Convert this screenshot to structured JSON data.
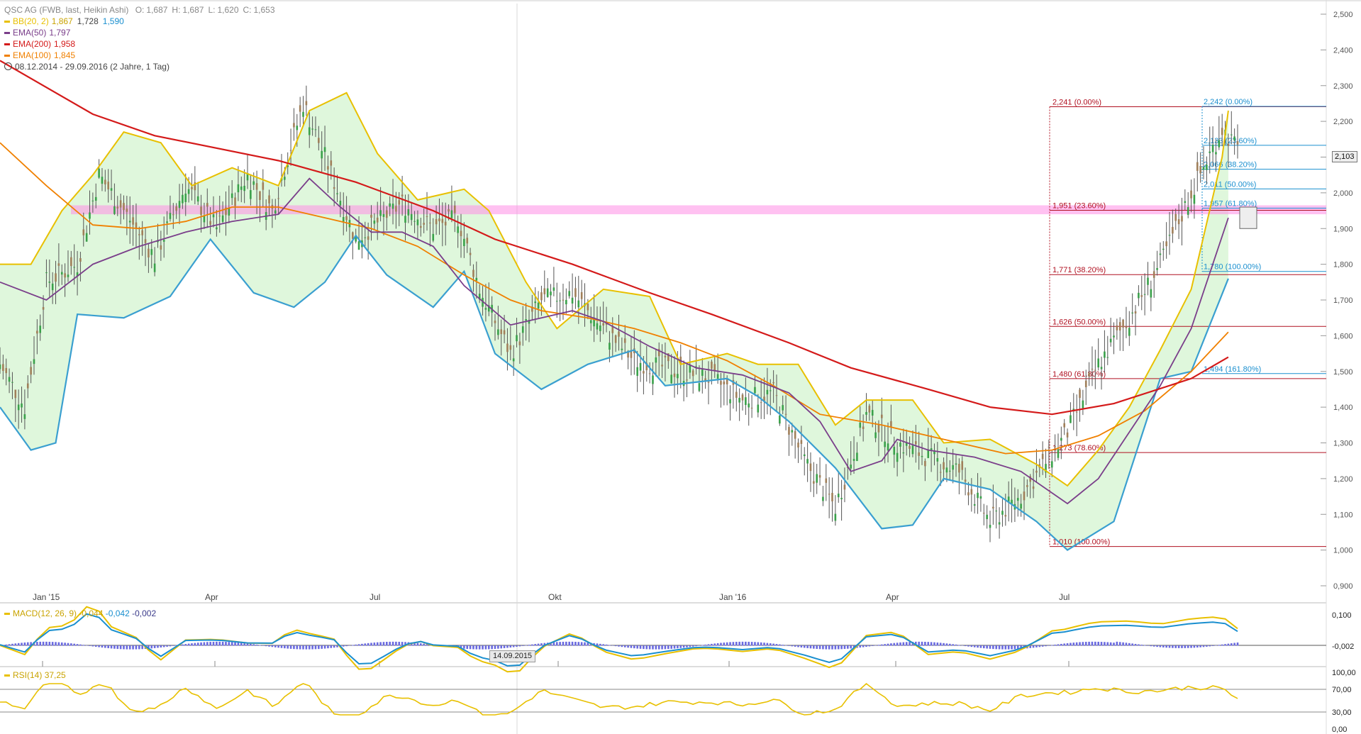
{
  "header": {
    "title": "QSC AG (FWB, last, Heikin Ashi)",
    "ohlc": [
      {
        "k": "O:",
        "v": "1,687"
      },
      {
        "k": "H:",
        "v": "1,687"
      },
      {
        "k": "L:",
        "v": "1,620"
      },
      {
        "k": "C:",
        "v": "1,653"
      }
    ],
    "indicators": [
      {
        "name": "BB(20, 2)",
        "values": [
          "1,867",
          "1,728",
          "1,590"
        ],
        "color": "#e8c000",
        "value_colors": [
          "#c9a300",
          "#444444",
          "#1a8fcf"
        ]
      },
      {
        "name": "EMA(50)",
        "values": [
          "1,797"
        ],
        "color": "#7a3e8a",
        "value_colors": [
          "#7a3e8a"
        ]
      },
      {
        "name": "EMA(200)",
        "values": [
          "1,958"
        ],
        "color": "#d41a1a",
        "value_colors": [
          "#d41a1a"
        ]
      },
      {
        "name": "EMA(100)",
        "values": [
          "1,845"
        ],
        "color": "#f08000",
        "value_colors": [
          "#f08000"
        ]
      }
    ],
    "range": "08.12.2014 - 29.09.2016 (2 Jahre, 1 Tag)"
  },
  "macd_label": {
    "name": "MACD(12, 26, 9)",
    "values": [
      "-0,044",
      "-0,042",
      "-0,002"
    ]
  },
  "rsi_label": {
    "name": "RSI(14)",
    "values": [
      "37,25"
    ]
  },
  "cursor_date": "14.09.2015",
  "last_price": "2,103",
  "chart_data": {
    "type": "line",
    "price_axis": {
      "ticks": [
        "2,500",
        "2,400",
        "2,300",
        "2,200",
        "2,100",
        "2,000",
        "1,900",
        "1,800",
        "1,700",
        "1,600",
        "1,500",
        "1,400",
        "1,300",
        "1,200",
        "1,100",
        "1,000",
        "0,900"
      ],
      "ylim": [
        0.9,
        2.5
      ]
    },
    "time_axis": {
      "labels": [
        "Jan '15",
        "Apr",
        "Jul",
        "Okt",
        "Jan '16",
        "Apr",
        "Jul"
      ]
    },
    "series": [
      {
        "name": "EMA(200)",
        "color": "#d41a1a",
        "points": [
          [
            0,
            2.37
          ],
          [
            30,
            2.22
          ],
          [
            50,
            2.16
          ],
          [
            90,
            2.09
          ],
          [
            115,
            2.03
          ],
          [
            140,
            1.95
          ],
          [
            160,
            1.87
          ],
          [
            185,
            1.8
          ],
          [
            210,
            1.72
          ],
          [
            230,
            1.66
          ],
          [
            255,
            1.58
          ],
          [
            275,
            1.51
          ],
          [
            300,
            1.45
          ],
          [
            320,
            1.4
          ],
          [
            340,
            1.38
          ],
          [
            360,
            1.41
          ],
          [
            385,
            1.48
          ],
          [
            397,
            1.54
          ]
        ]
      },
      {
        "name": "EMA(100)",
        "color": "#f08000",
        "points": [
          [
            0,
            2.14
          ],
          [
            15,
            2.02
          ],
          [
            30,
            1.91
          ],
          [
            45,
            1.9
          ],
          [
            60,
            1.92
          ],
          [
            75,
            1.96
          ],
          [
            90,
            1.96
          ],
          [
            105,
            1.93
          ],
          [
            120,
            1.9
          ],
          [
            135,
            1.85
          ],
          [
            150,
            1.77
          ],
          [
            165,
            1.7
          ],
          [
            175,
            1.67
          ],
          [
            190,
            1.65
          ],
          [
            205,
            1.62
          ],
          [
            220,
            1.58
          ],
          [
            235,
            1.53
          ],
          [
            250,
            1.46
          ],
          [
            265,
            1.38
          ],
          [
            285,
            1.35
          ],
          [
            305,
            1.31
          ],
          [
            325,
            1.27
          ],
          [
            340,
            1.28
          ],
          [
            355,
            1.32
          ],
          [
            370,
            1.39
          ],
          [
            385,
            1.5
          ],
          [
            397,
            1.61
          ]
        ]
      },
      {
        "name": "EMA(50)",
        "color": "#7a3e8a",
        "points": [
          [
            0,
            1.75
          ],
          [
            15,
            1.7
          ],
          [
            30,
            1.8
          ],
          [
            45,
            1.85
          ],
          [
            60,
            1.89
          ],
          [
            75,
            1.92
          ],
          [
            90,
            1.94
          ],
          [
            100,
            2.04
          ],
          [
            110,
            1.96
          ],
          [
            120,
            1.89
          ],
          [
            130,
            1.89
          ],
          [
            140,
            1.85
          ],
          [
            150,
            1.74
          ],
          [
            165,
            1.63
          ],
          [
            175,
            1.65
          ],
          [
            185,
            1.67
          ],
          [
            195,
            1.64
          ],
          [
            210,
            1.57
          ],
          [
            225,
            1.51
          ],
          [
            240,
            1.49
          ],
          [
            255,
            1.44
          ],
          [
            265,
            1.36
          ],
          [
            275,
            1.22
          ],
          [
            285,
            1.25
          ],
          [
            290,
            1.31
          ],
          [
            300,
            1.28
          ],
          [
            315,
            1.26
          ],
          [
            330,
            1.22
          ],
          [
            345,
            1.13
          ],
          [
            355,
            1.2
          ],
          [
            365,
            1.33
          ],
          [
            375,
            1.46
          ],
          [
            385,
            1.62
          ],
          [
            397,
            1.93
          ]
        ]
      },
      {
        "name": "BB upper",
        "color": "#e8c000",
        "points": [
          [
            0,
            1.8
          ],
          [
            10,
            1.8
          ],
          [
            20,
            1.95
          ],
          [
            30,
            2.05
          ],
          [
            40,
            2.17
          ],
          [
            52,
            2.14
          ],
          [
            62,
            2.02
          ],
          [
            75,
            2.07
          ],
          [
            90,
            2.02
          ],
          [
            100,
            2.23
          ],
          [
            112,
            2.28
          ],
          [
            122,
            2.11
          ],
          [
            135,
            1.98
          ],
          [
            150,
            2.01
          ],
          [
            158,
            1.95
          ],
          [
            170,
            1.75
          ],
          [
            180,
            1.62
          ],
          [
            195,
            1.73
          ],
          [
            210,
            1.71
          ],
          [
            220,
            1.52
          ],
          [
            235,
            1.55
          ],
          [
            245,
            1.52
          ],
          [
            258,
            1.52
          ],
          [
            270,
            1.35
          ],
          [
            280,
            1.42
          ],
          [
            295,
            1.42
          ],
          [
            305,
            1.3
          ],
          [
            320,
            1.31
          ],
          [
            335,
            1.24
          ],
          [
            345,
            1.18
          ],
          [
            355,
            1.28
          ],
          [
            365,
            1.4
          ],
          [
            375,
            1.56
          ],
          [
            385,
            1.73
          ],
          [
            395,
            2.1
          ],
          [
            397,
            2.23
          ]
        ]
      },
      {
        "name": "BB lower",
        "color": "#3a9fd0",
        "points": [
          [
            0,
            1.4
          ],
          [
            10,
            1.28
          ],
          [
            18,
            1.3
          ],
          [
            25,
            1.66
          ],
          [
            40,
            1.65
          ],
          [
            55,
            1.71
          ],
          [
            68,
            1.87
          ],
          [
            82,
            1.72
          ],
          [
            95,
            1.68
          ],
          [
            105,
            1.75
          ],
          [
            115,
            1.88
          ],
          [
            125,
            1.77
          ],
          [
            140,
            1.68
          ],
          [
            150,
            1.78
          ],
          [
            160,
            1.55
          ],
          [
            175,
            1.45
          ],
          [
            190,
            1.52
          ],
          [
            205,
            1.56
          ],
          [
            215,
            1.46
          ],
          [
            235,
            1.48
          ],
          [
            245,
            1.43
          ],
          [
            255,
            1.36
          ],
          [
            270,
            1.23
          ],
          [
            285,
            1.06
          ],
          [
            295,
            1.07
          ],
          [
            305,
            1.2
          ],
          [
            320,
            1.17
          ],
          [
            335,
            1.08
          ],
          [
            345,
            1.0
          ],
          [
            360,
            1.08
          ],
          [
            375,
            1.48
          ],
          [
            385,
            1.5
          ],
          [
            397,
            1.76
          ]
        ]
      },
      {
        "name": "Price",
        "color": "#4a4a4a",
        "points": [
          [
            0,
            1.52
          ],
          [
            8,
            1.4
          ],
          [
            15,
            1.75
          ],
          [
            25,
            1.8
          ],
          [
            32,
            2.05
          ],
          [
            40,
            1.95
          ],
          [
            50,
            1.82
          ],
          [
            60,
            2.02
          ],
          [
            70,
            1.9
          ],
          [
            80,
            2.05
          ],
          [
            88,
            1.95
          ],
          [
            98,
            2.25
          ],
          [
            105,
            2.1
          ],
          [
            115,
            1.87
          ],
          [
            130,
            1.97
          ],
          [
            140,
            1.9
          ],
          [
            148,
            1.93
          ],
          [
            155,
            1.73
          ],
          [
            165,
            1.55
          ],
          [
            175,
            1.7
          ],
          [
            185,
            1.72
          ],
          [
            195,
            1.62
          ],
          [
            205,
            1.53
          ],
          [
            215,
            1.51
          ],
          [
            230,
            1.48
          ],
          [
            240,
            1.42
          ],
          [
            250,
            1.44
          ],
          [
            260,
            1.25
          ],
          [
            270,
            1.12
          ],
          [
            280,
            1.38
          ],
          [
            290,
            1.3
          ],
          [
            300,
            1.26
          ],
          [
            310,
            1.22
          ],
          [
            320,
            1.08
          ],
          [
            330,
            1.15
          ],
          [
            345,
            1.33
          ],
          [
            355,
            1.52
          ],
          [
            365,
            1.65
          ],
          [
            375,
            1.8
          ],
          [
            385,
            2.0
          ],
          [
            395,
            2.18
          ],
          [
            400,
            2.12
          ]
        ]
      }
    ],
    "fib_red": [
      {
        "value": 2.241,
        "label": "2,241 (0.00%)"
      },
      {
        "value": 1.951,
        "label": "1,951 (23.60%)"
      },
      {
        "value": 1.771,
        "label": "1,771 (38.20%)"
      },
      {
        "value": 1.626,
        "label": "1,626 (50.00%)"
      },
      {
        "value": 1.48,
        "label": "1,480 (61.80%)"
      },
      {
        "value": 1.273,
        "label": "1,273 (78.60%)"
      },
      {
        "value": 1.01,
        "label": "1,010 (100.00%)"
      }
    ],
    "fib_blue": [
      {
        "value": 2.242,
        "label": "2,242 (0.00%)"
      },
      {
        "value": 2.133,
        "label": "2,133 (23.60%)"
      },
      {
        "value": 2.066,
        "label": "2,066 (38.20%)"
      },
      {
        "value": 2.011,
        "label": "2,011 (50.00%)"
      },
      {
        "value": 1.957,
        "label": "1,957 (61.80%)"
      },
      {
        "value": 1.78,
        "label": "1,780 (100.00%)"
      },
      {
        "value": 1.494,
        "label": "1,494 (161.80%)"
      }
    ],
    "resistance_band": [
      1.94,
      1.965
    ],
    "macd": {
      "ticks": [
        "0,100",
        "-0,002"
      ],
      "ylim": [
        -0.07,
        0.14
      ]
    },
    "rsi": {
      "ticks": [
        "100,00",
        "70,00",
        "30,00",
        "0,00"
      ],
      "ylim": [
        0,
        100
      ]
    }
  }
}
